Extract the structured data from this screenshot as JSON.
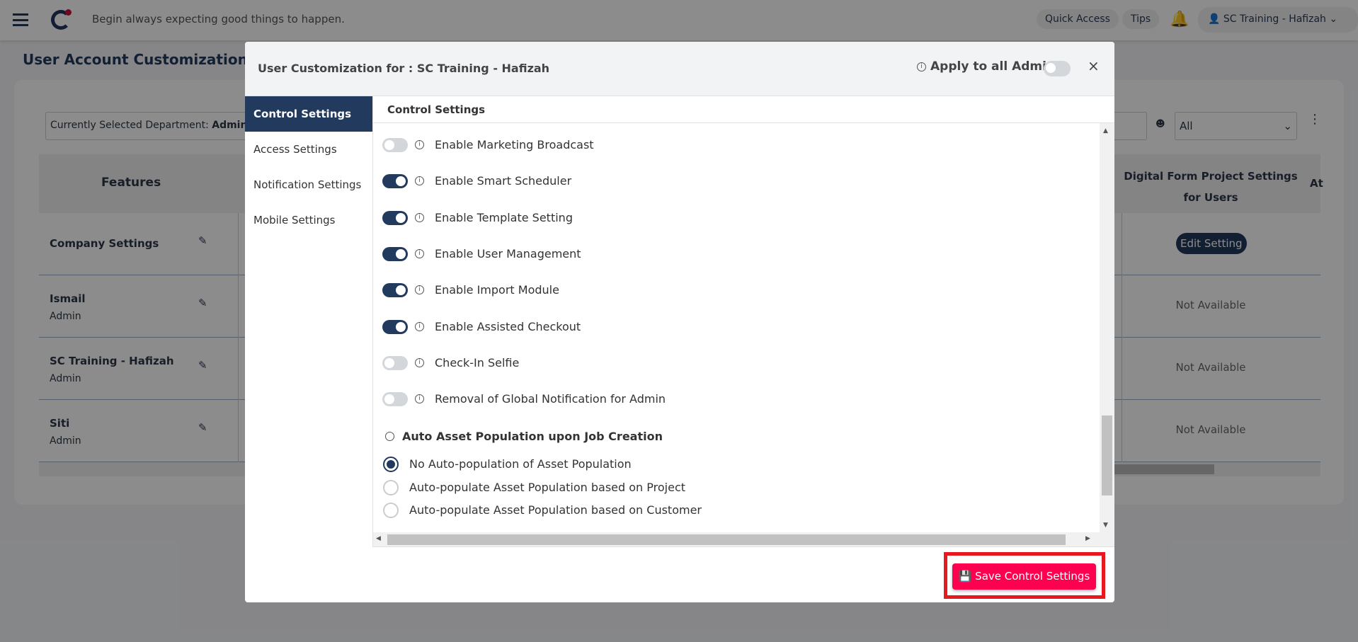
{
  "topbar": {
    "tagline": "Begin always expecting good things to happen.",
    "quick_access": "Quick Access",
    "tips": "Tips",
    "user": "SC Training - Hafizah"
  },
  "page": {
    "title": "User Account Customization",
    "department_label": "Currently Selected Department: ",
    "department_value": "Admin",
    "filter_value": "All",
    "table": {
      "features_header": "Features",
      "digital_form_header": "Digital Form Project Settings for Users",
      "cut_header": "At",
      "rows": [
        {
          "name": "Company Settings",
          "role": "",
          "value": "Edit Setting"
        },
        {
          "name": "Ismail",
          "role": "Admin",
          "value": "Not Available"
        },
        {
          "name": "SC Training - Hafizah",
          "role": "Admin",
          "value": "Not Available"
        },
        {
          "name": "Siti",
          "role": "Admin",
          "value": "Not Available"
        }
      ]
    }
  },
  "modal": {
    "title": "User Customization for : SC Training - Hafizah",
    "apply_all": "Apply to all Admin",
    "apply_all_on": false,
    "nav": [
      "Control Settings",
      "Access Settings",
      "Notification Settings",
      "Mobile Settings"
    ],
    "section_title": "Control Settings",
    "toggles": [
      {
        "label": "Enable Marketing Broadcast",
        "on": false
      },
      {
        "label": "Enable Smart Scheduler",
        "on": true
      },
      {
        "label": "Enable Template Setting",
        "on": true
      },
      {
        "label": "Enable User Management",
        "on": true
      },
      {
        "label": "Enable Import Module",
        "on": true
      },
      {
        "label": "Enable Assisted Checkout",
        "on": true
      },
      {
        "label": "Check-In Selfie",
        "on": false
      },
      {
        "label": "Removal of Global Notification for Admin",
        "on": false
      }
    ],
    "radio_group": {
      "title": "Auto Asset Population upon Job Creation",
      "options": [
        {
          "label": "No Auto-population of Asset Population",
          "selected": true
        },
        {
          "label": "Auto-populate Asset Population based on Project",
          "selected": false
        },
        {
          "label": "Auto-populate Asset Population based on Customer",
          "selected": false
        }
      ]
    },
    "save_label": "Save Control Settings"
  },
  "colors": {
    "navy": "#223a5e",
    "save": "#ff0050",
    "highlight": "#e8191e"
  }
}
